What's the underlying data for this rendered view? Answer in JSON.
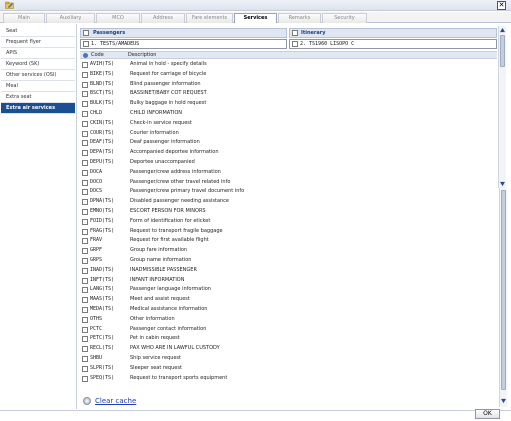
{
  "window": {
    "close_glyph": "✕",
    "app_icon": "folder-edit-icon"
  },
  "tabs": [
    "Main",
    "Auxiliary",
    "MCO",
    "Address",
    "Fare elements",
    "Services",
    "Remarks",
    "Security"
  ],
  "active_tab": "Services",
  "sidebar": {
    "items": [
      "Seat",
      "Frequent flyer",
      "APIS",
      "Keyword (SK)",
      "Other services (OSI)",
      "Meal",
      "Extra seat",
      "Extra air services"
    ],
    "active": "Extra air services"
  },
  "passengers": {
    "label": "Passengers",
    "value": "1. TESTS/AMADEUS"
  },
  "itinerary": {
    "label": "Itinerary",
    "value": "2. TS1960 LISOPO C"
  },
  "list": {
    "code_header": "Code",
    "description_header": "Description"
  },
  "services": [
    {
      "code": "AVIH(TS)",
      "description": "Animal in hold - specify details"
    },
    {
      "code": "BIKE(TS)",
      "description": "Request for carriage of bicycle"
    },
    {
      "code": "BLND(TS)",
      "description": "Blind passenger information"
    },
    {
      "code": "BSCT(TS)",
      "description": "BASSINET/BABY COT REQUEST"
    },
    {
      "code": "BULK(TS)",
      "description": "Bulky baggage in hold request"
    },
    {
      "code": "CHLD",
      "description": "CHILD INFORMATION"
    },
    {
      "code": "CKIN(TS)",
      "description": "Check-in service request"
    },
    {
      "code": "COUR(TS)",
      "description": "Courier information"
    },
    {
      "code": "DEAF(TS)",
      "description": "Deaf passenger information"
    },
    {
      "code": "DEPA(TS)",
      "description": "Accompanied deportee information"
    },
    {
      "code": "DEPU(TS)",
      "description": "Deportee unaccompanied"
    },
    {
      "code": "DOCA",
      "description": "Passenger/crew address information"
    },
    {
      "code": "DOCO",
      "description": "Passenger/crew other travel related info"
    },
    {
      "code": "DOCS",
      "description": "Passenger/crew primary travel document info"
    },
    {
      "code": "DPNA(TS)",
      "description": "Disabled passenger needing assistance"
    },
    {
      "code": "EMNO(TS)",
      "description": "ESCORT PERSON FOR MINORS"
    },
    {
      "code": "FOID(TS)",
      "description": "Form of identification for eticket"
    },
    {
      "code": "FRAG(TS)",
      "description": "Request to transport fragile baggage"
    },
    {
      "code": "FRAV",
      "description": "Request for first available flight"
    },
    {
      "code": "GRPF",
      "description": "Group fare information"
    },
    {
      "code": "GRPS",
      "description": "Group name information"
    },
    {
      "code": "INAD(TS)",
      "description": "INADMISSIBLE PASSENGER"
    },
    {
      "code": "INFT(TS)",
      "description": "INFANT INFORMATION"
    },
    {
      "code": "LANG(TS)",
      "description": "Passenger language information"
    },
    {
      "code": "MAAS(TS)",
      "description": "Meet and assist request"
    },
    {
      "code": "MEDA(TS)",
      "description": "Medical assistance information"
    },
    {
      "code": "OTHS",
      "description": "Other information"
    },
    {
      "code": "PCTC",
      "description": "Passenger contact information"
    },
    {
      "code": "PETC(TS)",
      "description": "Pet in cabin request"
    },
    {
      "code": "RECL(TS)",
      "description": "PAX WHO ARE IN LAWFUL CUSTODY"
    },
    {
      "code": "SHBU",
      "description": "Ship service request"
    },
    {
      "code": "SLPR(TS)",
      "description": "Sleeper seat request"
    },
    {
      "code": "SPEQ(TS)",
      "description": "Request to transport sports equipment"
    }
  ],
  "footer": {
    "clear_cache": "Clear cache",
    "ok": "OK"
  },
  "colors": {
    "active_sidebar": "#1b4f92",
    "header_blue": "#1b3f7a",
    "link": "#1c3fb3"
  }
}
